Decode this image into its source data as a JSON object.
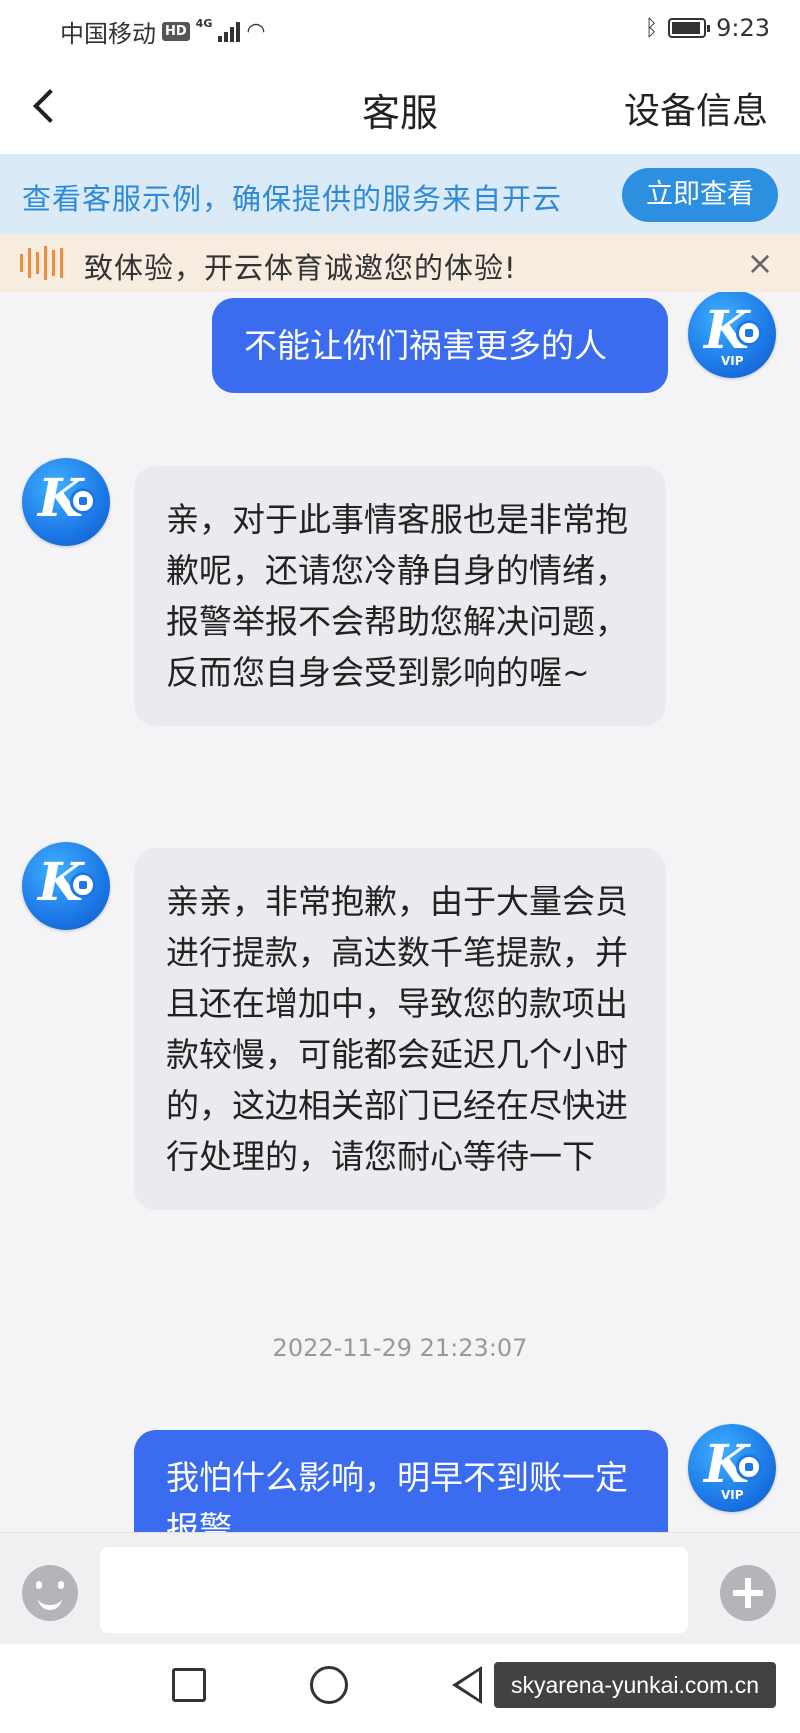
{
  "status_bar": {
    "carrier": "中国移动",
    "hd": "HD",
    "network": "4G",
    "time": "9:23"
  },
  "nav": {
    "title": "客服",
    "right_label": "设备信息",
    "back_icon": "chevron-left-icon"
  },
  "notice": {
    "text": "查看客服示例，确保提供的服务来自开云",
    "button": "立即查看"
  },
  "marquee": {
    "text": "致体验，开云体育诚邀您的体验!",
    "close": "×"
  },
  "messages": [
    {
      "sender": "user",
      "text": "不能让你们祸害更多的人"
    },
    {
      "sender": "agent",
      "text": "亲，对于此事情客服也是非常抱歉呢，还请您冷静自身的情绪，报警举报不会帮助您解决问题，反而您自身会受到影响的喔~"
    },
    {
      "sender": "agent",
      "text": "亲亲，非常抱歉，由于大量会员进行提款，高达数千笔提款，并且还在增加中，导致您的款项出款较慢，可能都会延迟几个小时的，这边相关部门已经在尽快进行处理的，请您耐心等待一下"
    },
    {
      "sender": "user",
      "text": "我怕什么影响，明早不到账一定报警"
    }
  ],
  "timestamp": "2022-11-29 21:23:07",
  "avatar": {
    "letter": "K",
    "vip_label": "VIP"
  },
  "input": {
    "placeholder": ""
  },
  "watermark": "skyarena-yunkai.com.cn",
  "colors": {
    "user_bubble": "#3b6cf0",
    "agent_bubble": "#ebebef",
    "notice_bg": "#dbeaf7",
    "notice_text": "#2d8ad6",
    "notice_button": "#2c8fe0",
    "marquee_bg": "#f7ece0",
    "marquee_icon": "#f08c3b"
  }
}
